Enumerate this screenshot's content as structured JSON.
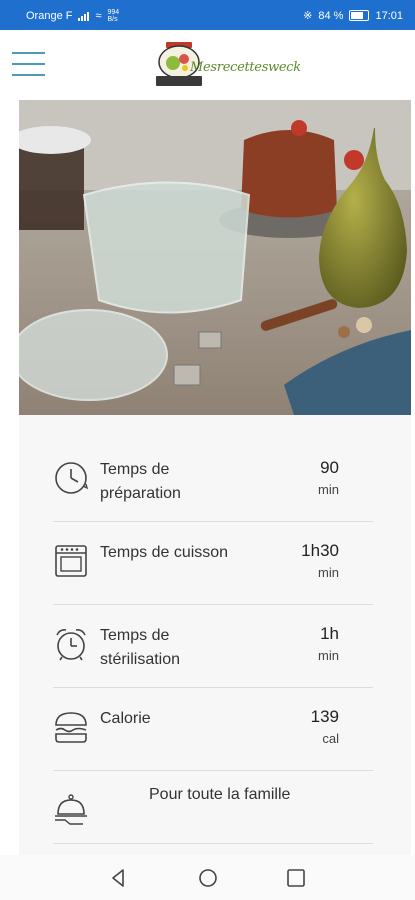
{
  "status_bar": {
    "carrier": "Orange F",
    "net_speed": "994\nB/s",
    "battery": "84 %",
    "time": "17:01"
  },
  "app_bar": {
    "logo_text": "Mesrecettesweck"
  },
  "recipe_info": {
    "rows": [
      {
        "icon": "clock-icon",
        "label": "Temps de préparation",
        "value": "90",
        "unit": "min"
      },
      {
        "icon": "oven-icon",
        "label": "Temps de cuisson",
        "value": "1h30",
        "unit": "min"
      },
      {
        "icon": "alarm-clock-icon",
        "label": "Temps de stérilisation",
        "value": "1h",
        "unit": "min"
      },
      {
        "icon": "burger-icon",
        "label": "Calorie",
        "value": "139",
        "unit": "cal"
      },
      {
        "icon": "serving-dish-icon",
        "label": "Pour toute la famille"
      }
    ]
  },
  "colors": {
    "status_bar": "#1f6fcf",
    "menu_icon": "#4f9ab3",
    "logo_green": "#5c8a2a"
  }
}
